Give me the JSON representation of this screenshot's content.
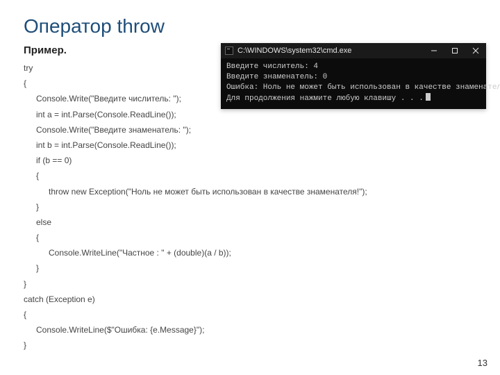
{
  "slide": {
    "title": "Оператор throw",
    "subtitle": "Пример.",
    "page_number": "13"
  },
  "code": {
    "lines": [
      {
        "indent": 0,
        "text": "try"
      },
      {
        "indent": 0,
        "text": "{"
      },
      {
        "indent": 1,
        "text": "Console.Write(\"Введите числитель: \");"
      },
      {
        "indent": 1,
        "text": "int a = int.Parse(Console.ReadLine());"
      },
      {
        "indent": 1,
        "text": "Console.Write(\"Введите знаменатель: \");"
      },
      {
        "indent": 1,
        "text": "int b = int.Parse(Console.ReadLine());"
      },
      {
        "indent": 1,
        "text": "if (b == 0)"
      },
      {
        "indent": 1,
        "text": "{"
      },
      {
        "indent": 2,
        "text": "throw new Exception(\"Ноль не может быть использован в качестве знаменателя!\");"
      },
      {
        "indent": 1,
        "text": "}"
      },
      {
        "indent": 1,
        "text": "else"
      },
      {
        "indent": 1,
        "text": "{"
      },
      {
        "indent": 2,
        "text": "Console.WriteLine(\"Частное : \" + (double)(a / b));"
      },
      {
        "indent": 1,
        "text": "}"
      },
      {
        "indent": 0,
        "text": "}"
      },
      {
        "indent": 0,
        "text": "catch (Exception e)"
      },
      {
        "indent": 0,
        "text": "{"
      },
      {
        "indent": 1,
        "text": "Console.WriteLine($\"Ошибка: {e.Message}\");"
      },
      {
        "indent": 0,
        "text": "}"
      }
    ]
  },
  "console": {
    "title": "C:\\WINDOWS\\system32\\cmd.exe",
    "lines": [
      "Введите числитель: 4",
      "Введите знаменатель: 0",
      "Ошибка: Ноль не может быть использован в качестве знаменателя!",
      "Для продолжения нажмите любую клавишу . . ."
    ]
  }
}
